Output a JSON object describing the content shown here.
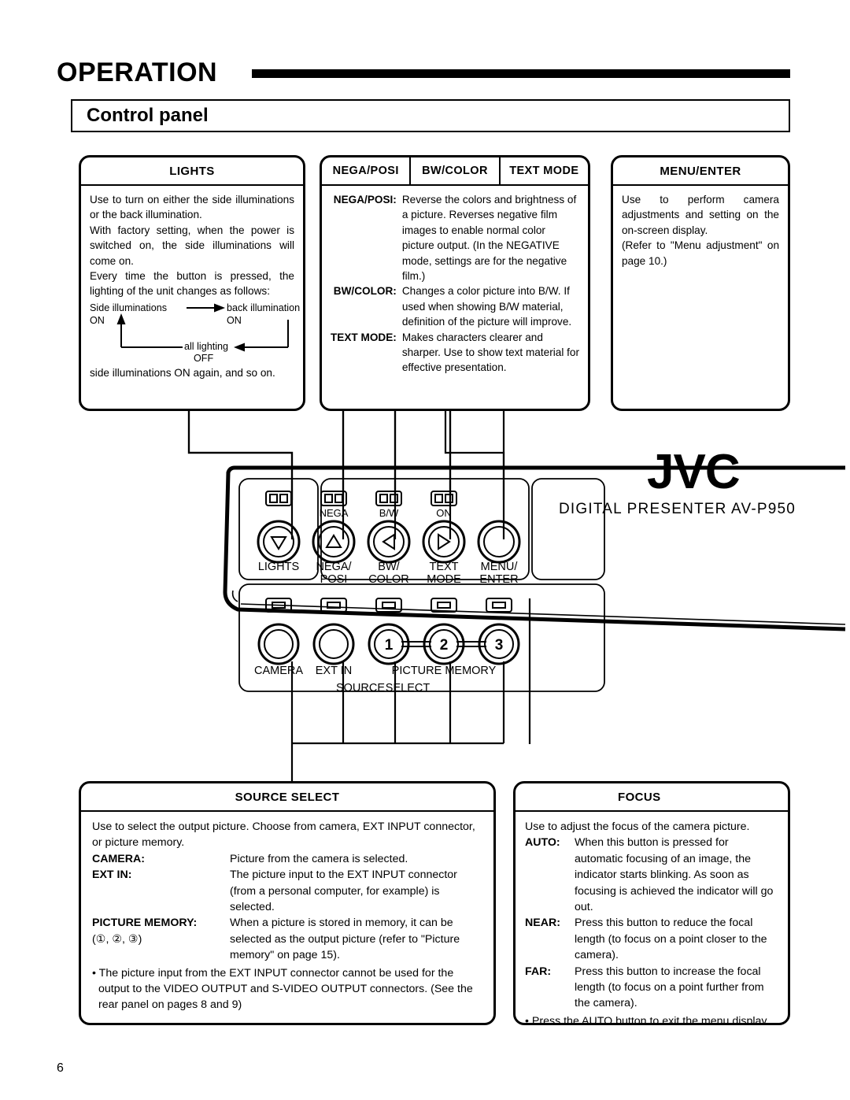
{
  "header": {
    "section_title": "OPERATION",
    "subtitle": "Control panel"
  },
  "page_number": "6",
  "callouts": {
    "lights": {
      "title": "LIGHTS",
      "paragraphs": [
        "Use to turn on either the side illuminations or the back illumination.",
        "With factory setting, when the power is switched on, the side illuminations will come on.",
        "Every time the button is pressed, the lighting of the unit changes as follows:"
      ],
      "cycle": {
        "node1_line1": "Side illuminations",
        "node1_line2": "ON",
        "node2_line1": "back illumination",
        "node2_line2": "ON",
        "node3_line1": "all lighting",
        "node3_line2": "OFF"
      },
      "closing": "side illuminations ON again, and so on."
    },
    "nega_posi": {
      "tabs": [
        "NEGA/POSI",
        "BW/COLOR",
        "TEXT MODE"
      ],
      "rows": [
        {
          "term": "NEGA/POSI:",
          "desc": "Reverse the colors and brightness of a picture. Reverses negative film images to enable normal color picture output. (In the NEGATIVE mode, settings are for the negative film.)"
        },
        {
          "term": "BW/COLOR:",
          "desc": "Changes a color picture into B/W. If used when showing B/W material, definition of the picture will improve."
        },
        {
          "term": "TEXT MODE:",
          "desc": "Makes characters clearer and sharper. Use to show text material for effective presentation."
        }
      ]
    },
    "menu_enter": {
      "title": "MENU/ENTER",
      "paragraphs": [
        "Use to perform camera adjustments and setting on the on-screen display.",
        "(Refer to \"Menu adjustment\" on page 10.)"
      ]
    },
    "source_select": {
      "title": "SOURCE SELECT",
      "intro": "Use to select the output picture. Choose from camera, EXT INPUT connector, or picture memory.",
      "rows": [
        {
          "term": "CAMERA:",
          "desc": "Picture from the camera is selected."
        },
        {
          "term": "EXT IN:",
          "desc": "The picture input to the EXT INPUT connector (from a personal computer, for example) is selected."
        },
        {
          "term": "PICTURE MEMORY:",
          "term2": "(①, ②, ③)",
          "desc": "When a picture is stored in memory, it can be selected as the output picture (refer to \"Picture memory\" on page 15)."
        }
      ],
      "bullet": "• The picture input from the EXT INPUT connector cannot be used for the output to the VIDEO OUTPUT and S-VIDEO OUTPUT connectors. (See the rear panel on pages 8 and 9)"
    },
    "focus": {
      "title": "FOCUS",
      "intro": "Use to adjust the focus of the camera picture.",
      "rows": [
        {
          "term": "AUTO:",
          "desc": "When this button is pressed for automatic focusing of an image, the indicator starts blinking. As soon as focusing is achieved the indicator will go out."
        },
        {
          "term": "NEAR:",
          "desc": "Press this button to reduce the focal length (to focus on a point closer to the camera)."
        },
        {
          "term": "FAR:",
          "desc": "Press this button to increase the focal length (to focus on a point further from the camera)."
        }
      ],
      "bullet": "• Press the AUTO button to exit the menu display."
    }
  },
  "panel": {
    "brand": "JVC",
    "model_line": "DIGITAL  PRESENTER  AV-P950",
    "led_labels": [
      "NEGA",
      "B/W",
      "ON"
    ],
    "top_buttons": [
      {
        "label_line1": "LIGHTS",
        "label_line2": "",
        "glyph": "triangle-down"
      },
      {
        "label_line1": "NEGA/",
        "label_line2": "POSI",
        "glyph": "triangle-up"
      },
      {
        "label_line1": "BW/",
        "label_line2": "COLOR",
        "glyph": "triangle-left"
      },
      {
        "label_line1": "TEXT",
        "label_line2": "MODE",
        "glyph": "triangle-right"
      },
      {
        "label_line1": "MENU/",
        "label_line2": "ENTER",
        "glyph": "none"
      }
    ],
    "bottom_buttons": [
      {
        "label": "CAMERA",
        "digit": ""
      },
      {
        "label": "EXT IN",
        "digit": ""
      },
      {
        "label": "",
        "digit": "1"
      },
      {
        "label": "",
        "digit": "2"
      },
      {
        "label": "",
        "digit": "3"
      }
    ],
    "picture_memory_label": "PICTURE MEMORY",
    "source_select_label_left": "SOURCE",
    "source_select_label_right": "SELECT"
  }
}
